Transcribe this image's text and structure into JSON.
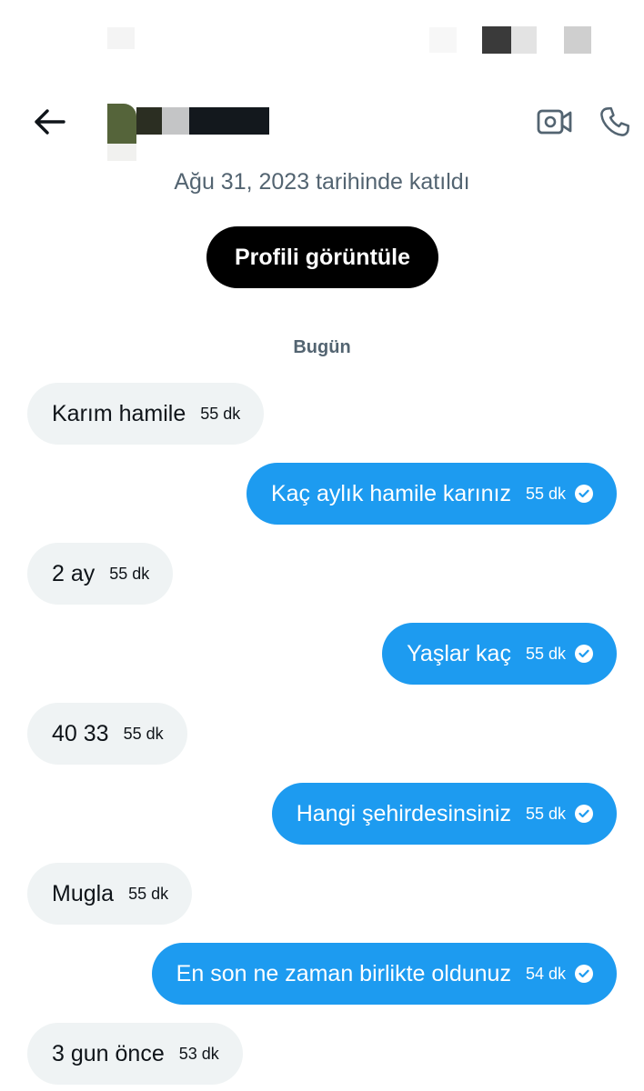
{
  "header": {
    "back_icon": "arrow-left-icon",
    "video_icon": "video-camera-icon",
    "phone_icon": "phone-icon"
  },
  "profile": {
    "joined": "Ağu 31, 2023 tarihinde katıldı",
    "view_profile_label": "Profili görüntüle"
  },
  "conversation": {
    "day_label": "Bugün",
    "messages": [
      {
        "direction": "incoming",
        "text": "Karım hamile",
        "time": "55 dk"
      },
      {
        "direction": "outgoing",
        "text": "Kaç aylık hamile karınız",
        "time": "55 dk",
        "status_icon": "read-check-icon"
      },
      {
        "direction": "incoming",
        "text": "2 ay",
        "time": "55 dk"
      },
      {
        "direction": "outgoing",
        "text": "Yaşlar kaç",
        "time": "55 dk",
        "status_icon": "read-check-icon"
      },
      {
        "direction": "incoming",
        "text": "40 33",
        "time": "55 dk"
      },
      {
        "direction": "outgoing",
        "text": "Hangi şehirdesinsiniz",
        "time": "55 dk",
        "status_icon": "read-check-icon"
      },
      {
        "direction": "incoming",
        "text": "Mugla",
        "time": "55 dk"
      },
      {
        "direction": "outgoing",
        "text": "En son ne zaman birlikte oldunuz",
        "time": "54 dk",
        "status_icon": "read-check-icon"
      },
      {
        "direction": "incoming",
        "text": "3 gun önce",
        "time": "53 dk"
      }
    ]
  },
  "colors": {
    "outgoing_bubble": "#1d9bf0",
    "incoming_bubble": "#eff3f4",
    "secondary_text": "#536471"
  }
}
